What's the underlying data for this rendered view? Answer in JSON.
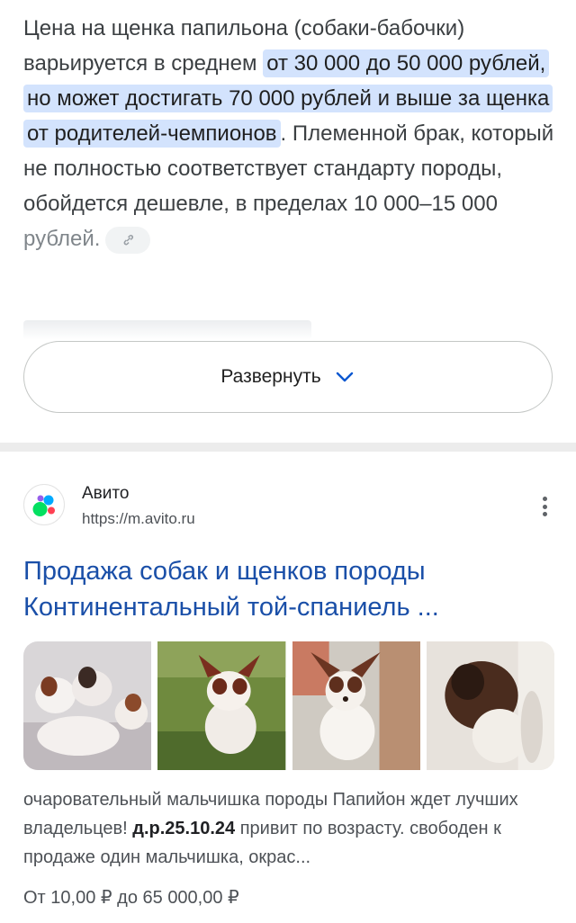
{
  "snippet": {
    "part1": "Цена на щенка папильона (собаки-бабочки) варьируется в среднем ",
    "highlight": "от 30 000 до 50 000 рублей, но может достигать 70 000 рублей и выше за щенка от родителей-чемпионов",
    "part2": ". Племенной брак, который не полностью соответствует стандарту породы, обойдется дешевле, в пределах 10 000–15 000",
    "tail": "рублей.",
    "link_icon": "link-icon"
  },
  "expand": {
    "label": "Развернуть",
    "icon": "chevron-down-icon"
  },
  "result": {
    "source_name": "Авито",
    "source_url": "https://m.avito.ru",
    "more_icon": "more-vertical-icon",
    "title": "Продажа собак и щенков породы Континентальный той-спаниель ...",
    "description_before": "очаровательный мальчишка породы Папийон ждет лучших владельцев! ",
    "description_bold": "д.р.25.10.24",
    "description_after": " привит по возрасту. свободен к продаже один мальчишка, окрас...",
    "price": "От 10,00 ₽ до 65 000,00 ₽",
    "thumbnails": [
      "puppy-photo-1",
      "puppy-photo-2",
      "puppy-photo-3",
      "puppy-photo-4"
    ]
  },
  "colors": {
    "highlight": "#d3e3fd",
    "link": "#1a4fa8",
    "avito_blue": "#0af",
    "avito_green": "#04e061",
    "avito_red": "#ff4053",
    "avito_purple": "#965eeb"
  }
}
